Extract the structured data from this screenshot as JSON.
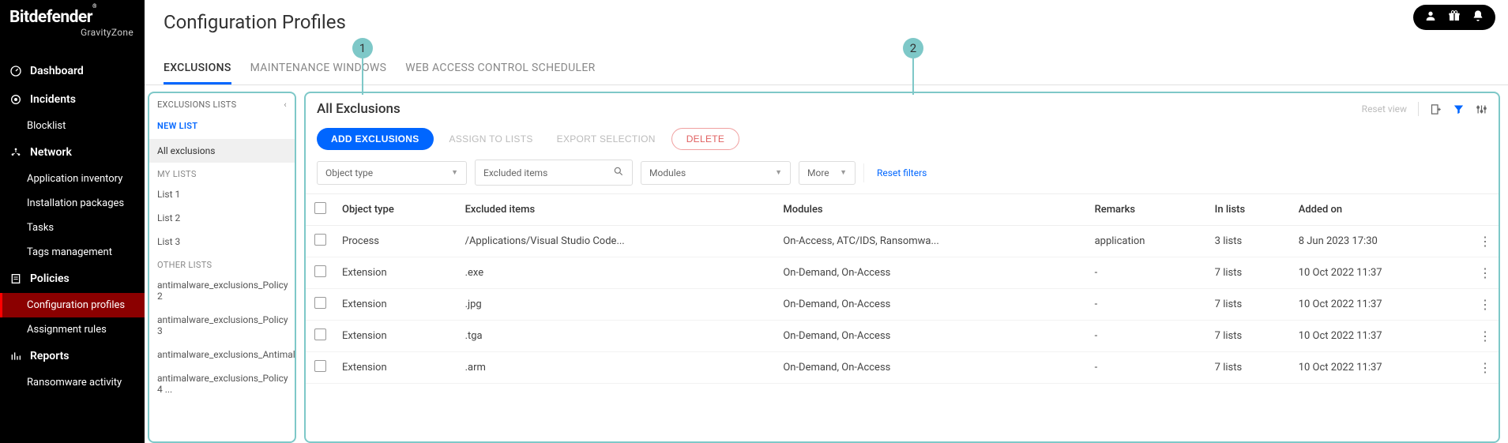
{
  "brand": {
    "name": "Bitdefender",
    "suffix": "GravityZone"
  },
  "topbar": {
    "user_icon": "user",
    "help_icon": "gift",
    "bell_icon": "bell"
  },
  "sidebar": {
    "items": [
      {
        "label": "Dashboard",
        "icon": "dashboard"
      },
      {
        "label": "Incidents",
        "icon": "incidents",
        "subs": [
          {
            "label": "Blocklist"
          }
        ]
      },
      {
        "label": "Network",
        "icon": "network",
        "subs": [
          {
            "label": "Application inventory"
          },
          {
            "label": "Installation packages"
          },
          {
            "label": "Tasks"
          },
          {
            "label": "Tags management"
          }
        ]
      },
      {
        "label": "Policies",
        "icon": "policies",
        "subs": [
          {
            "label": "Configuration profiles",
            "active": true
          },
          {
            "label": "Assignment rules"
          }
        ]
      },
      {
        "label": "Reports",
        "icon": "reports",
        "subs": [
          {
            "label": "Ransomware activity"
          }
        ]
      }
    ]
  },
  "page": {
    "title": "Configuration Profiles"
  },
  "tabs": [
    {
      "label": "EXCLUSIONS",
      "active": true
    },
    {
      "label": "MAINTENANCE WINDOWS"
    },
    {
      "label": "WEB ACCESS CONTROL SCHEDULER"
    }
  ],
  "callouts": {
    "one": "1",
    "two": "2"
  },
  "excl_panel": {
    "header": "EXCLUSIONS LISTS",
    "new_list": "NEW LIST",
    "all": "All exclusions",
    "section_my": "MY LISTS",
    "my_lists": [
      "List 1",
      "List 2",
      "List 3"
    ],
    "section_other": "OTHER LISTS",
    "other_lists": [
      "antimalware_exclusions_Policy 2",
      "antimalware_exclusions_Policy 3",
      "antimalware_exclusions_Antimal...",
      "antimalware_exclusions_Policy 4 ..."
    ]
  },
  "table_panel": {
    "title": "All Exclusions",
    "reset_view": "Reset view",
    "actions": {
      "add": "ADD EXCLUSIONS",
      "assign": "ASSIGN TO LISTS",
      "export": "EXPORT SELECTION",
      "delete": "DELETE"
    },
    "filters": {
      "object_type": "Object type",
      "excluded_items": "Excluded items",
      "modules": "Modules",
      "more": "More",
      "reset": "Reset filters"
    },
    "columns": [
      "Object type",
      "Excluded items",
      "Modules",
      "Remarks",
      "In lists",
      "Added on"
    ],
    "rows": [
      {
        "type": "Process",
        "item": "/Applications/Visual Studio Code...",
        "modules": "On-Access, ATC/IDS, Ransomwa...",
        "remarks": "application",
        "lists": "3 lists",
        "added": "8 Jun 2023 17:30"
      },
      {
        "type": "Extension",
        "item": ".exe",
        "modules": "On-Demand, On-Access",
        "remarks": "-",
        "lists": "7 lists",
        "added": "10 Oct 2022 11:37"
      },
      {
        "type": "Extension",
        "item": ".jpg",
        "modules": "On-Demand, On-Access",
        "remarks": "-",
        "lists": "7 lists",
        "added": "10 Oct 2022 11:37"
      },
      {
        "type": "Extension",
        "item": ".tga",
        "modules": "On-Demand, On-Access",
        "remarks": "-",
        "lists": "7 lists",
        "added": "10 Oct 2022 11:37"
      },
      {
        "type": "Extension",
        "item": ".arm",
        "modules": "On-Demand, On-Access",
        "remarks": "-",
        "lists": "7 lists",
        "added": "10 Oct 2022 11:37"
      }
    ]
  }
}
